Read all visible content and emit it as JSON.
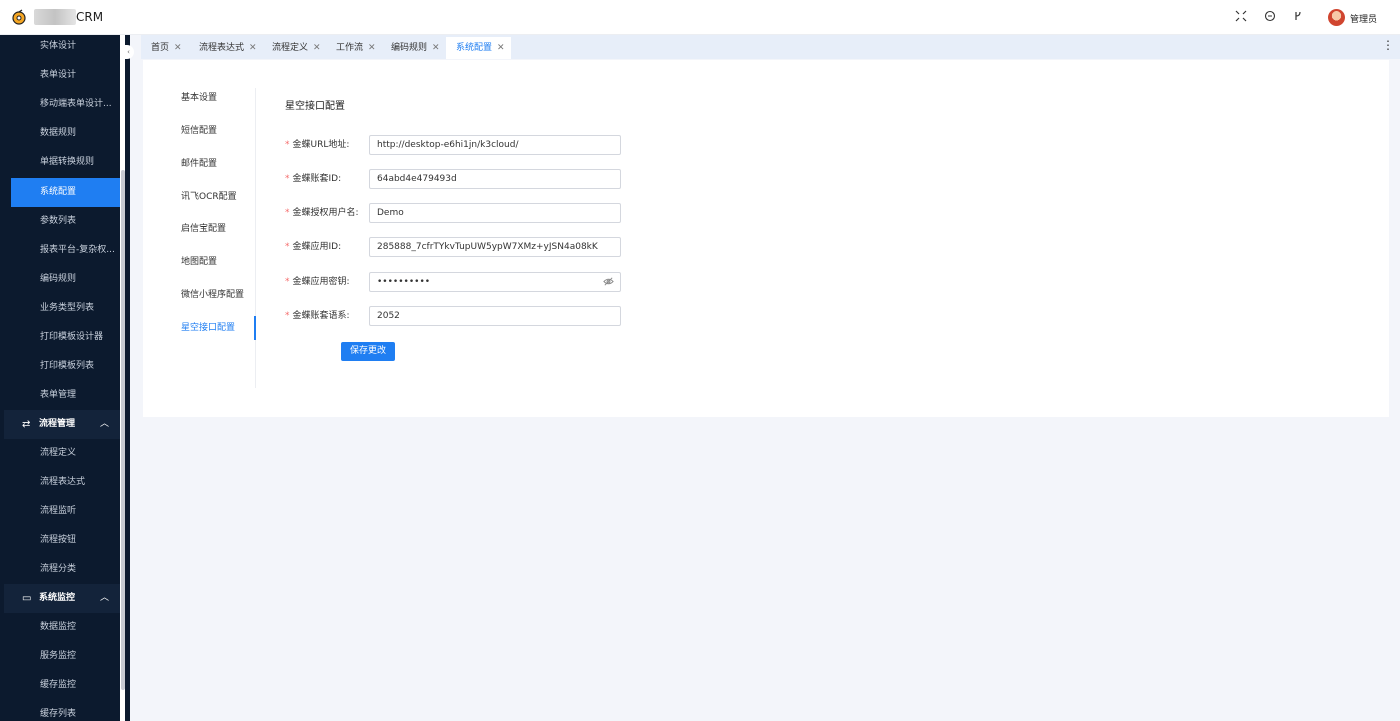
{
  "header": {
    "brand": "CRM",
    "user_name": "管理员",
    "icons": [
      "fullscreen-icon",
      "message-icon",
      "branch-icon"
    ]
  },
  "sidebar": {
    "items_top": [
      "实体设计",
      "表单设计",
      "移动端表单设计...",
      "数据规则",
      "单据转换规则",
      "系统配置",
      "参数列表",
      "报表平台-复杂权...",
      "编码规则",
      "业务类型列表",
      "打印模板设计器",
      "打印模板列表",
      "表单管理"
    ],
    "active_item": "系统配置",
    "group_workflow": {
      "label": "流程管理",
      "items": [
        "流程定义",
        "流程表达式",
        "流程监听",
        "流程按钮",
        "流程分类"
      ]
    },
    "group_monitor": {
      "label": "系统监控",
      "items": [
        "数据监控",
        "服务监控",
        "缓存监控",
        "缓存列表"
      ]
    }
  },
  "tabs": [
    "首页",
    "流程表达式",
    "流程定义",
    "工作流",
    "编码规则",
    "系统配置"
  ],
  "active_tab": "系统配置",
  "settings_menu": [
    "基本设置",
    "短信配置",
    "邮件配置",
    "讯飞OCR配置",
    "启信宝配置",
    "地图配置",
    "微信小程序配置",
    "星空接口配置"
  ],
  "active_menu": "星空接口配置",
  "form": {
    "title": "星空接口配置",
    "fields": [
      {
        "label": "金蝶URL地址:",
        "value": "http://desktop-e6hi1jn/k3cloud/"
      },
      {
        "label": "金蝶账套ID:",
        "value": "64abd4e479493d"
      },
      {
        "label": "金蝶授权用户名:",
        "value": "Demo"
      },
      {
        "label": "金蝶应用ID:",
        "value": "285888_7cfrTYkvTupUW5ypW7XMz+yJSN4a08kK"
      },
      {
        "label": "金蝶应用密钥:",
        "value": "••••••••••"
      },
      {
        "label": "金蝶账套语系:",
        "value": "2052"
      }
    ],
    "save_label": "保存更改",
    "required_mark": "*"
  },
  "colors": {
    "accent": "#1f7ef2",
    "sidebar_bg": "#0c1a2e",
    "required": "#f56c6c"
  }
}
